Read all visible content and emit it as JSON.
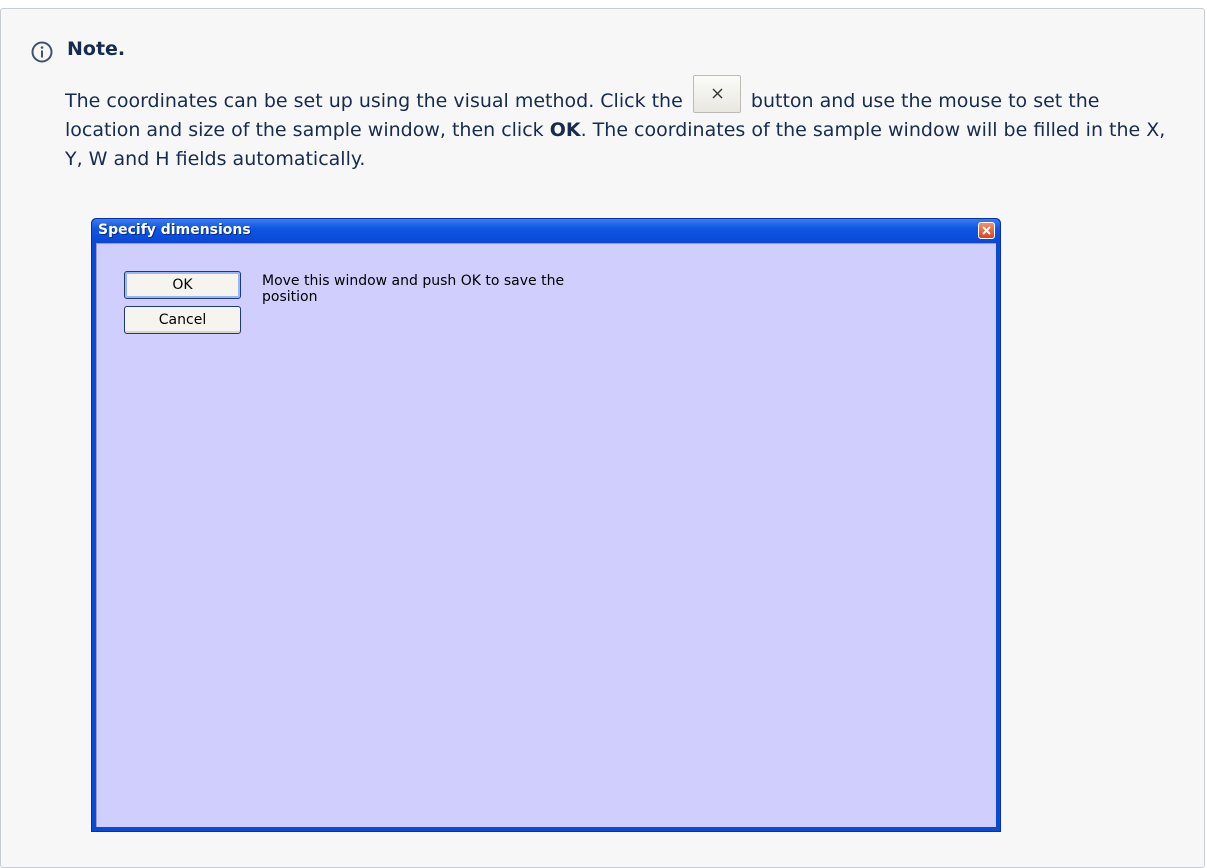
{
  "note": {
    "icon": "info-icon",
    "title": "Note.",
    "text_before_button": "The coordinates can be set up using the visual method. Click the",
    "inline_button_icon": "x-mark-icon",
    "text_after_button": "button and use the mouse to set the location and size of the sample window, then click",
    "bold_ok": "OK",
    "text_end": ". The coordinates of the sample window will be filled in the X, Y, W and H fields automatically."
  },
  "dialog": {
    "title": "Specify dimensions",
    "close_icon": "close-icon",
    "ok_label": "OK",
    "cancel_label": "Cancel",
    "message": "Move this window and push OK to save the position"
  },
  "colors": {
    "client_background": "#cfcefc",
    "titlebar": "#0a4ad8",
    "note_text": "#172b4d"
  }
}
